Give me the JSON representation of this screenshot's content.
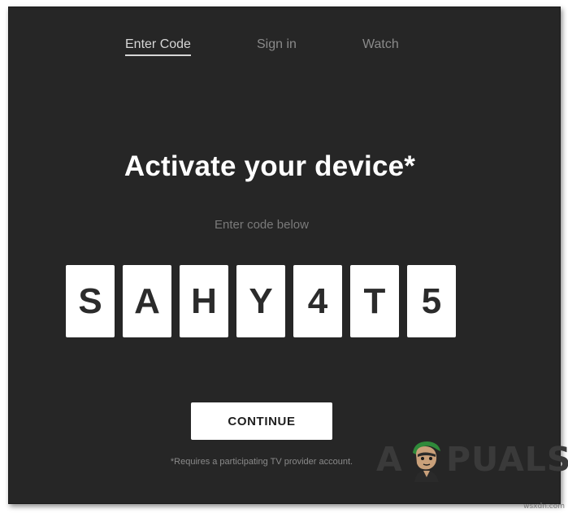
{
  "steps": [
    {
      "label": "Enter Code",
      "active": true
    },
    {
      "label": "Sign in",
      "active": false
    },
    {
      "label": "Watch",
      "active": false
    }
  ],
  "title": "Activate your device*",
  "subtitle": "Enter code below",
  "code": [
    "S",
    "A",
    "H",
    "Y",
    "4",
    "T",
    "5"
  ],
  "continue_label": "CONTINUE",
  "footnote": "*Requires a participating TV provider account.",
  "watermark": {
    "left": "A",
    "right": "PUALS",
    "icon": "appuals-mascot-icon"
  },
  "site_credit": "wsxdn.com",
  "colors": {
    "panel_background": "#262626",
    "text_primary": "#ffffff",
    "text_muted": "#8a8a8a",
    "code_box": "#ffffff",
    "code_text": "#2b2b2b"
  }
}
